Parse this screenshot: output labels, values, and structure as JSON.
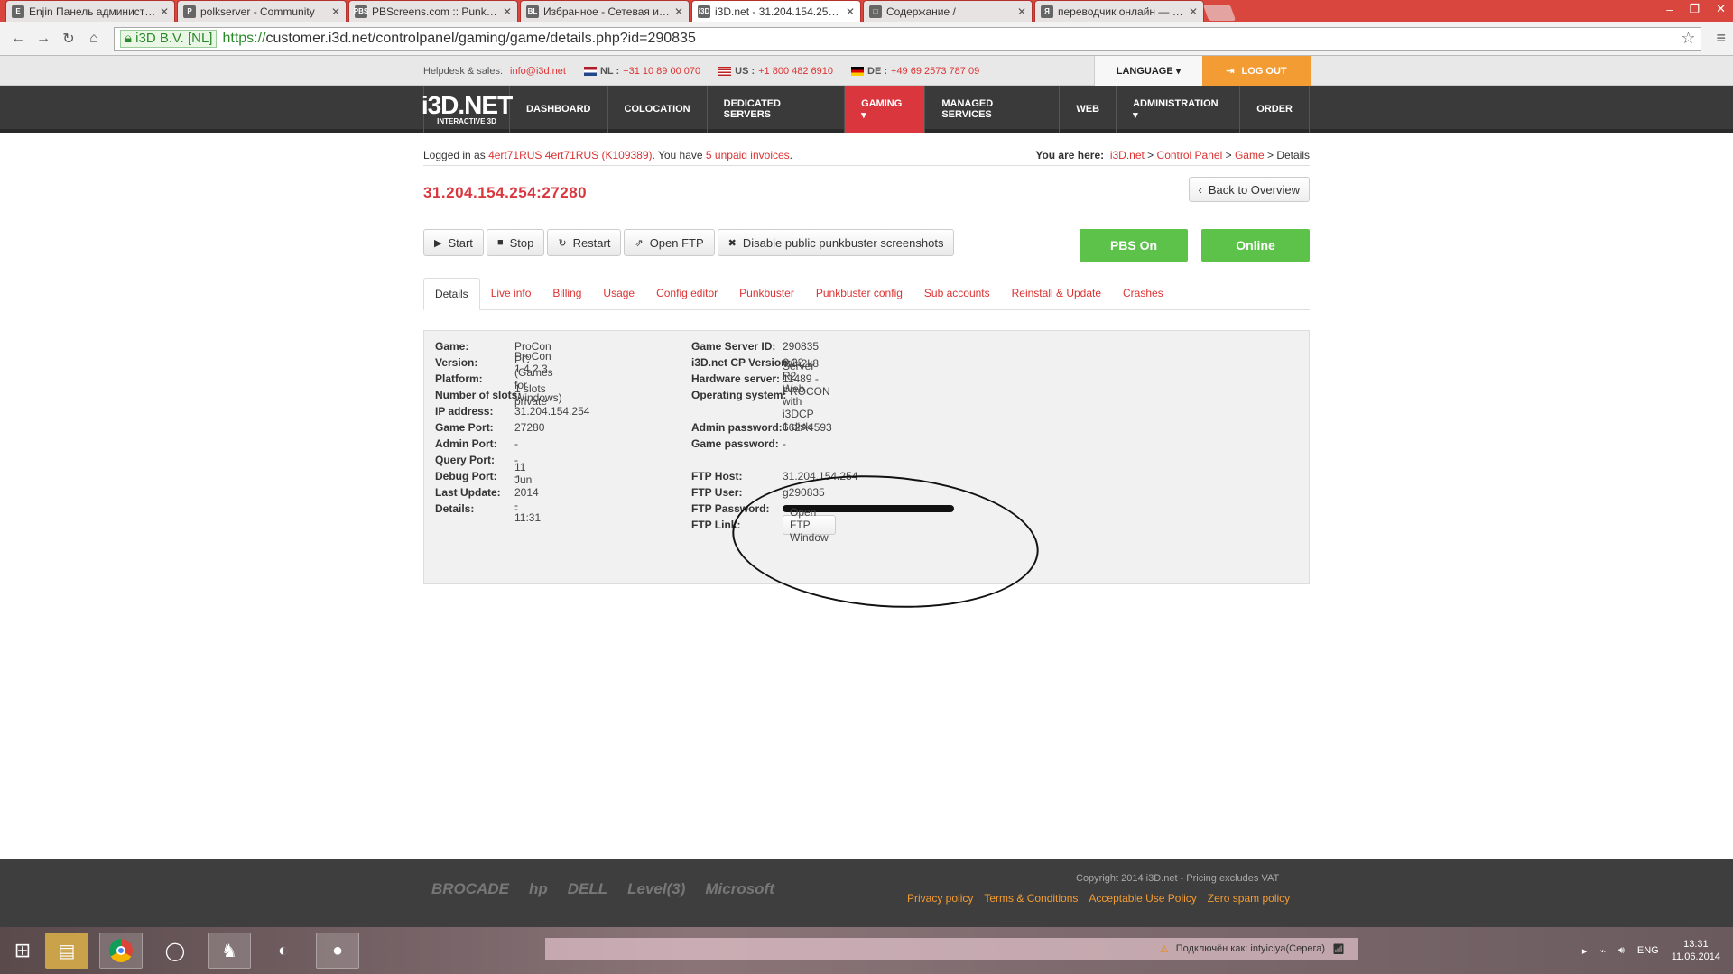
{
  "browser": {
    "tabs": [
      {
        "icon": "E",
        "title": "Enjin Панель администра…",
        "active": false
      },
      {
        "icon": "P",
        "title": "polkserver - Community",
        "active": false
      },
      {
        "icon": "PBS",
        "title": "PBScreens.com :: Punk Bu…",
        "active": false
      },
      {
        "icon": "BL",
        "title": "Избранное - Сетевая игр…",
        "active": false
      },
      {
        "icon": "i3D",
        "title": "i3D.net - 31.204.154.254:…",
        "active": true
      },
      {
        "icon": "□",
        "title": "Содержание /",
        "active": false
      },
      {
        "icon": "Я",
        "title": "переводчик онлайн — Я…",
        "active": false
      }
    ],
    "ev_label": "i3D B.V. [NL]",
    "url_scheme": "https://",
    "url_rest": "customer.i3d.net/controlpanel/gaming/game/details.php?id=290835"
  },
  "topbar": {
    "helpdesk": "Helpdesk & sales:",
    "email": "info@i3d.net",
    "nl_label": "NL :",
    "nl_phone": "+31 10 89 00 070",
    "us_label": "US :",
    "us_phone": "+1 800 482 6910",
    "de_label": "DE :",
    "de_phone": "+49 69 2573 787 09",
    "language": "LANGUAGE ▾",
    "logout": "LOG OUT"
  },
  "logo": {
    "big": "i3D.NET",
    "small": "INTERACTIVE 3D"
  },
  "nav": [
    "DASHBOARD",
    "COLOCATION",
    "DEDICATED SERVERS",
    "GAMING ▾",
    "MANAGED SERVICES",
    "WEB",
    "ADMINISTRATION ▾",
    "ORDER"
  ],
  "login": {
    "prefix": "Logged in as ",
    "user": "4ert71RUS 4ert71RUS (K109389)",
    "mid": ". You have ",
    "invoices": "5 unpaid invoices",
    "end": ".",
    "here": "You are here: ",
    "c1": "i3D.net",
    "c2": "Control Panel",
    "c3": "Game",
    "c4": "Details"
  },
  "server_title": "31.204.154.254:27280",
  "back": "Back to Overview",
  "buttons": {
    "start": "Start",
    "stop": "Stop",
    "restart": "Restart",
    "ftp": "Open FTP",
    "pbss": "Disable public punkbuster screenshots",
    "pbs": "PBS On",
    "online": "Online"
  },
  "tabs": [
    "Details",
    "Live info",
    "Billing",
    "Usage",
    "Config editor",
    "Punkbuster",
    "Punkbuster config",
    "Sub accounts",
    "Reinstall & Update",
    "Crashes"
  ],
  "details_left": [
    {
      "k": "Game:",
      "v": "ProCon"
    },
    {
      "k": "Version:",
      "v": "ProCon 1.4.2.3"
    },
    {
      "k": "Platform:",
      "v": "PC (Games for Windows)"
    },
    {
      "k": "Number of slots:",
      "v": "1 slots private"
    },
    {
      "k": "IP address:",
      "v": "31.204.154.254"
    },
    {
      "k": "Game Port:",
      "v": "27280"
    },
    {
      "k": "Admin Port:",
      "v": "-"
    },
    {
      "k": "Query Port:",
      "v": "-"
    },
    {
      "k": "Debug Port:",
      "v": "-"
    },
    {
      "k": "Last Update:",
      "v": "11 Jun 2014 - 11:31"
    },
    {
      "k": "Details:",
      "v": "-"
    }
  ],
  "details_right": [
    {
      "k": "Game Server ID:",
      "v": "290835"
    },
    {
      "k": "i3D.net CP Version:",
      "v": "6.22"
    },
    {
      "k": "Hardware server:",
      "v": "Server 11489 - PROCON"
    },
    {
      "k": "Operating system:",
      "v": "Win2k8 R2 Web with i3DCP 1 disk"
    },
    {
      "k": "Admin password:",
      "v": "662A4593"
    },
    {
      "k": "Game password:",
      "v": "-"
    },
    {
      "k": "FTP Host:",
      "v": "31.204.154.254"
    },
    {
      "k": "FTP User:",
      "v": "g290835"
    },
    {
      "k": "FTP Password:",
      "v": ""
    },
    {
      "k": "FTP Link:",
      "v": "Open FTP Window"
    }
  ],
  "footer": {
    "partners": [
      "BROCADE",
      "hp",
      "DELL",
      "Level(3)",
      "Microsoft"
    ],
    "copyright": "Copyright 2014 i3D.net - Pricing excludes VAT",
    "links": [
      "Privacy policy",
      "Terms & Conditions",
      "Acceptable Use Policy",
      "Zero spam policy"
    ]
  },
  "taskbar": {
    "notice": "Подключён как: intyiciya(Серега)",
    "lang": "ENG",
    "time": "13:31",
    "date": "11.06.2014"
  }
}
